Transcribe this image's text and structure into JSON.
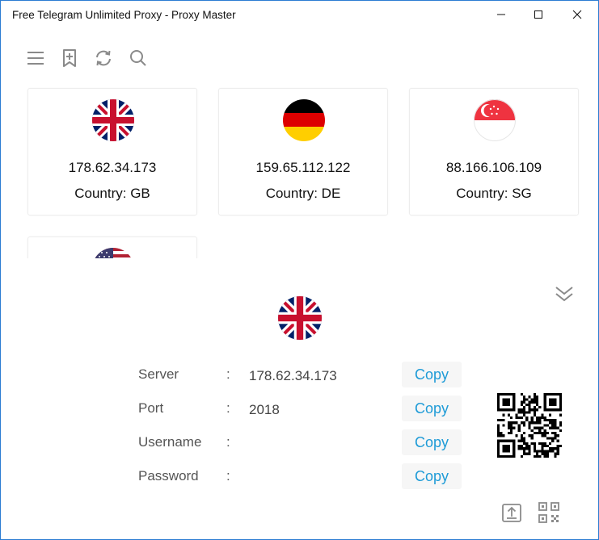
{
  "window": {
    "title": "Free Telegram Unlimited Proxy - Proxy Master",
    "controls": {
      "minimize": "minimize-icon",
      "maximize": "maximize-icon",
      "close": "close-icon"
    }
  },
  "toolbar": {
    "icons": [
      "menu-icon",
      "bookmark-add-icon",
      "refresh-icon",
      "search-icon"
    ]
  },
  "proxies": [
    {
      "ip": "178.62.34.173",
      "country": "Country: GB",
      "flag": "flag-gb-icon"
    },
    {
      "ip": "159.65.112.122",
      "country": "Country: DE",
      "flag": "flag-de-icon"
    },
    {
      "ip": "88.166.106.109",
      "country": "Country: SG",
      "flag": "flag-sg-icon"
    },
    {
      "ip": "",
      "country": "",
      "flag": "flag-us-icon"
    }
  ],
  "detail": {
    "flag": "flag-gb-icon",
    "fields": [
      {
        "label": "Server",
        "colon": ":",
        "value": "178.62.34.173",
        "copy": "Copy"
      },
      {
        "label": "Port",
        "colon": ":",
        "value": "2018",
        "copy": "Copy"
      },
      {
        "label": "Username",
        "colon": ":",
        "value": "",
        "copy": "Copy"
      },
      {
        "label": "Password",
        "colon": ":",
        "value": "",
        "copy": "Copy"
      }
    ],
    "qr": "qr-code",
    "bottom_icons": [
      "share-icon",
      "qr-scan-icon"
    ]
  },
  "colors": {
    "accent": "#1e9bd7",
    "border": "#2b7cd3"
  }
}
